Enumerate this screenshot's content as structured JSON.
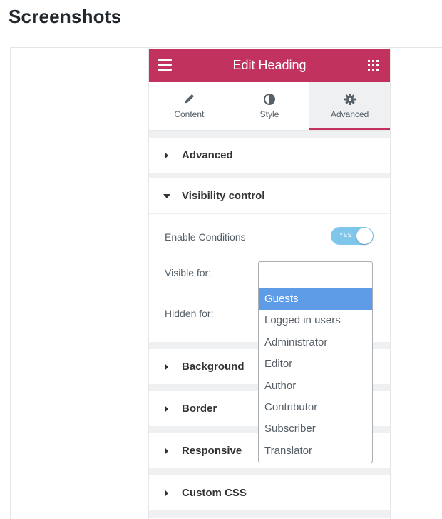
{
  "page": {
    "title": "Screenshots"
  },
  "panel": {
    "header_title": "Edit Heading",
    "tabs": [
      {
        "label": "Content",
        "icon": "pencil-icon"
      },
      {
        "label": "Style",
        "icon": "half-circle-icon"
      },
      {
        "label": "Advanced",
        "icon": "gear-icon",
        "active": true
      }
    ],
    "sections": {
      "advanced": "Advanced",
      "visibility": "Visibility control",
      "background": "Background",
      "border": "Border",
      "responsive": "Responsive",
      "custom_css": "Custom CSS"
    },
    "visibility": {
      "enable_label": "Enable Conditions",
      "toggle_text": "YES",
      "visible_label": "Visible for:",
      "hidden_label": "Hidden for:",
      "options": [
        "Guests",
        "Logged in users",
        "Administrator",
        "Editor",
        "Author",
        "Contributor",
        "Subscriber",
        "Translator"
      ],
      "highlighted_option": "Guests"
    },
    "colors": {
      "brand": "#c2325e",
      "toggle": "#7ec7ea",
      "highlight": "#5f9ce8"
    }
  }
}
